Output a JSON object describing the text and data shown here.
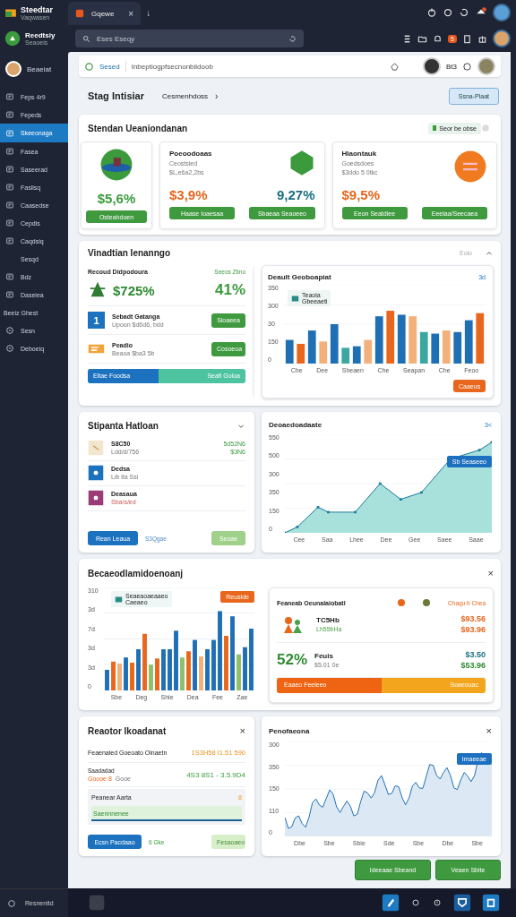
{
  "top_bar": {
    "app_name": "Steedtar",
    "app_caption": "Vaqwasen",
    "tabs": [
      {
        "label": "Gqewe",
        "selected": true
      }
    ],
    "tab_close": "×",
    "new_tab": "↓"
  },
  "side_header": {
    "brand": "Reedtsiy",
    "caption": "Seaoeis",
    "user": "Beaeiat"
  },
  "search": {
    "placeholder": "Eses Eseqy"
  },
  "toolbar": {
    "badge": "5"
  },
  "sidebar": {
    "items": [
      {
        "label": "Feps 4r9",
        "kind": "icon",
        "selected": false
      },
      {
        "label": "Fepeds",
        "kind": "icon",
        "selected": false
      },
      {
        "label": "Skeeonaga",
        "kind": "icon",
        "selected": true
      },
      {
        "label": "Fasea",
        "kind": "icon",
        "selected": false
      },
      {
        "label": "Saseerad",
        "kind": "icon",
        "selected": false
      },
      {
        "label": "Fasiisq",
        "kind": "icon",
        "selected": false
      },
      {
        "label": "Caasedse",
        "kind": "icon",
        "selected": false
      },
      {
        "label": "Cepdis",
        "kind": "icon",
        "selected": false
      },
      {
        "label": "Caqdsiq",
        "kind": "icon",
        "selected": false
      },
      {
        "label": "Sesqd",
        "kind": "plain",
        "selected": false
      },
      {
        "label": "Bdz",
        "kind": "icon",
        "selected": false
      },
      {
        "label": "Daseiea",
        "kind": "icon",
        "selected": false
      },
      {
        "label": "Beeiz Ghest",
        "kind": "heading",
        "selected": false
      },
      {
        "label": "Sesn",
        "kind": "round",
        "selected": false
      },
      {
        "label": "Deboeiq",
        "kind": "round",
        "selected": false
      }
    ],
    "footer": "Resnenitd"
  },
  "address_bar": {
    "label": "Sesed",
    "url": "Inbeptiogpfsecnonbiidoob",
    "user_code": "Bt3"
  },
  "header": {
    "title": "Stag Intisiar",
    "breadcrumb": "Cesmenhdoss",
    "chevron": "›",
    "button": "Ssna-Plaat"
  },
  "summary": {
    "title": "Stendan Ueaniondanan",
    "filter": "Seor be obse",
    "tiles": [
      {
        "kind": "globe",
        "values": [
          {
            "text": "$5,6%",
            "color": "#3a9a3c"
          }
        ],
        "buttons": [
          "Osteahdoen"
        ]
      },
      {
        "kind": "hexagon",
        "title": "Poeoodoaas",
        "lines": [
          "Ceostsied",
          "$L,e6a2,2bs"
        ],
        "values": [
          {
            "text": "$3,9%",
            "color": "#e4661d"
          },
          {
            "text": "9,27%",
            "color": "#17707e"
          }
        ],
        "buttons": [
          "Haase Ioaesaa",
          "Sbaeaa Seaoeeo"
        ]
      },
      {
        "kind": "circle",
        "title": "Hlaontauk",
        "lines": [
          "Goedsdoes",
          "$3ddo 5 0tkc"
        ],
        "values": [
          {
            "text": "$9,5%",
            "color": "#e4661d"
          }
        ],
        "buttons": [
          "Eeon Seatdiee",
          "Eeeiaa/Seecaea"
        ]
      }
    ]
  },
  "vitals": {
    "title": "Vinadtian Ienanngo",
    "menu": "Eoio",
    "panel": {
      "title": "Recoud Didpodoura",
      "link": "Seeos Ztino",
      "value": "$725%",
      "value_side": "41%",
      "rows": [
        {
          "kind": "number",
          "glyph": "1",
          "title": "Sebadt Gatanga",
          "detail": "Upoon $d6d6, bdd",
          "button": "Sioaeea"
        },
        {
          "kind": "ticket",
          "title": "Peadio",
          "detail": "Beaoa $ba3 5b",
          "button": "Cosoeoa"
        }
      ],
      "progress": {
        "left": "Eltae Foodsa",
        "right": "Seafi Goloa",
        "level": 0.45
      }
    },
    "chart": {
      "title": "Deault Geoboapiat",
      "corner": "3d",
      "y_labels": [
        "350",
        "300",
        "30",
        "150",
        "0"
      ],
      "legend": [
        "Teaoia",
        "Gbeeaeti"
      ],
      "x_labels": [
        "Che",
        "Dee",
        "Sheaen",
        "Che",
        "Seapan",
        "Che",
        "Feoo"
      ],
      "button": "Caaeus"
    }
  },
  "holdings": {
    "title": "Stipanta Hatloan",
    "rows": [
      {
        "kind": "note",
        "title": "S8C50",
        "detail": "Ldd/d/756",
        "values": [
          "5d52N6",
          "$3N6"
        ]
      },
      {
        "kind": "app",
        "color": "#1d72c0",
        "title": "Dedsa",
        "detail": "Lib ita Ssi",
        "values": []
      },
      {
        "kind": "app",
        "color": "#9b3c78",
        "title": "Deasaua",
        "detail": "Sba/s/ed",
        "values": []
      }
    ],
    "primary": "Rean Leaua",
    "link": "S3Qgae",
    "secondary": "Seoae"
  },
  "trend": {
    "title": "Deoaedoadaate",
    "corner": "3<",
    "y_labels": [
      "550",
      "500",
      "300",
      "350",
      "150",
      "0"
    ],
    "tooltip": "Sb Seaseeo",
    "x_labels": [
      "Cee",
      "Saa",
      "Lhee",
      "Dee",
      "Gee",
      "Saee",
      "Saae"
    ]
  },
  "breakdown": {
    "title": "Becaeodlamidoenoanj",
    "close": "×",
    "chart": {
      "y_labels": [
        "310",
        "3d",
        "7d",
        "3d",
        "3d",
        "0"
      ],
      "x_labels": [
        "Sbe",
        "Deg",
        "Shie",
        "Dea",
        "Fee",
        "Zae"
      ],
      "legend": [
        "Seaeaoaeaaeo",
        "Caeaeo"
      ],
      "tag": "Reuslde"
    },
    "panel": {
      "title": "Feaneab Oeunalaiobatl",
      "dots": [
        {
          "color": "#e8671c"
        },
        {
          "color": "#6b7a3a"
        }
      ],
      "link": "Chaqu b Chea",
      "rows": [
        {
          "kind": "figure",
          "title": "TC5Hb",
          "detail": "Lh55bHa",
          "values": [
            {
              "text": "$93.56",
              "color": "#e4661d"
            },
            {
              "text": "$93.96",
              "color": "#e4661d"
            }
          ]
        },
        {
          "kind": "percent",
          "lead": "52%",
          "title": "Feuis",
          "detail": "$5.01 0e",
          "values": [
            {
              "text": "$3.50",
              "color": "#17707e"
            },
            {
              "text": "$53.96",
              "color": "#2f8a32"
            }
          ]
        }
      ],
      "progress": {
        "left": "Eaaeo Feeleeo",
        "right": "Soaeouac",
        "level": 0.5
      }
    }
  },
  "report": {
    "title": "Reaotor Ikoadanat",
    "close": "×",
    "line1": {
      "label": "Feaenaled Goeoato Oinaetn",
      "value": "1S3H58 I1.51 590"
    },
    "line2": {
      "label": "Saadadad",
      "detail": "Goooe 8",
      "note": "Gooe",
      "value": "4S3 8S1 - 3.5.9D4"
    },
    "band": {
      "label": "Peanear Aarta",
      "badge": "8",
      "strip": "Saennnenee"
    },
    "primary": "Ecsn Pacdaao",
    "link": "6 Gke",
    "secondary": "Fesaoaeo"
  },
  "performance": {
    "title": "Penofaeona",
    "close": "×",
    "y_labels": [
      "300",
      "350",
      "150",
      "110",
      "0"
    ],
    "tooltip": "Imaeeae",
    "x_labels": [
      "Dbe",
      "Sbe",
      "Sbie",
      "Sde",
      "Sbe",
      "Dbe",
      "Sbe"
    ]
  },
  "actions": [
    "Ideeaae Sbeand",
    "Veaen Sbite"
  ]
}
